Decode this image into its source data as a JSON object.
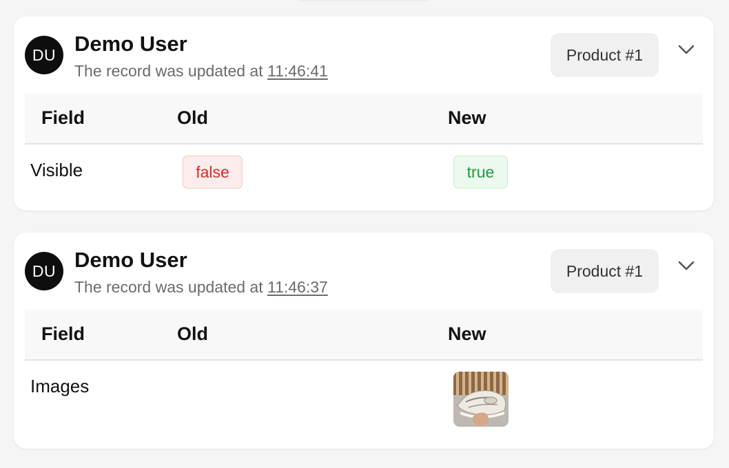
{
  "entries": [
    {
      "avatar_initials": "DU",
      "user_name": "Demo User",
      "subtitle_prefix": "The record was updated at ",
      "time": "11:46:41",
      "product": "Product #1",
      "columns": {
        "field": "Field",
        "old": "Old",
        "new": "New"
      },
      "change": {
        "field": "Visible",
        "old": "false",
        "new": "true"
      }
    },
    {
      "avatar_initials": "DU",
      "user_name": "Demo User",
      "subtitle_prefix": "The record was updated at ",
      "time": "11:46:37",
      "product": "Product #1",
      "columns": {
        "field": "Field",
        "old": "Old",
        "new": "New"
      },
      "change": {
        "field": "Images",
        "old": "",
        "new_image": "sneaker-photo"
      }
    }
  ],
  "colors": {
    "avatar_bg": "#0e0e0e",
    "old_badge_text": "#d62b2b",
    "new_badge_text": "#1e9b3f",
    "product_tag_bg": "#f0f0f0"
  }
}
